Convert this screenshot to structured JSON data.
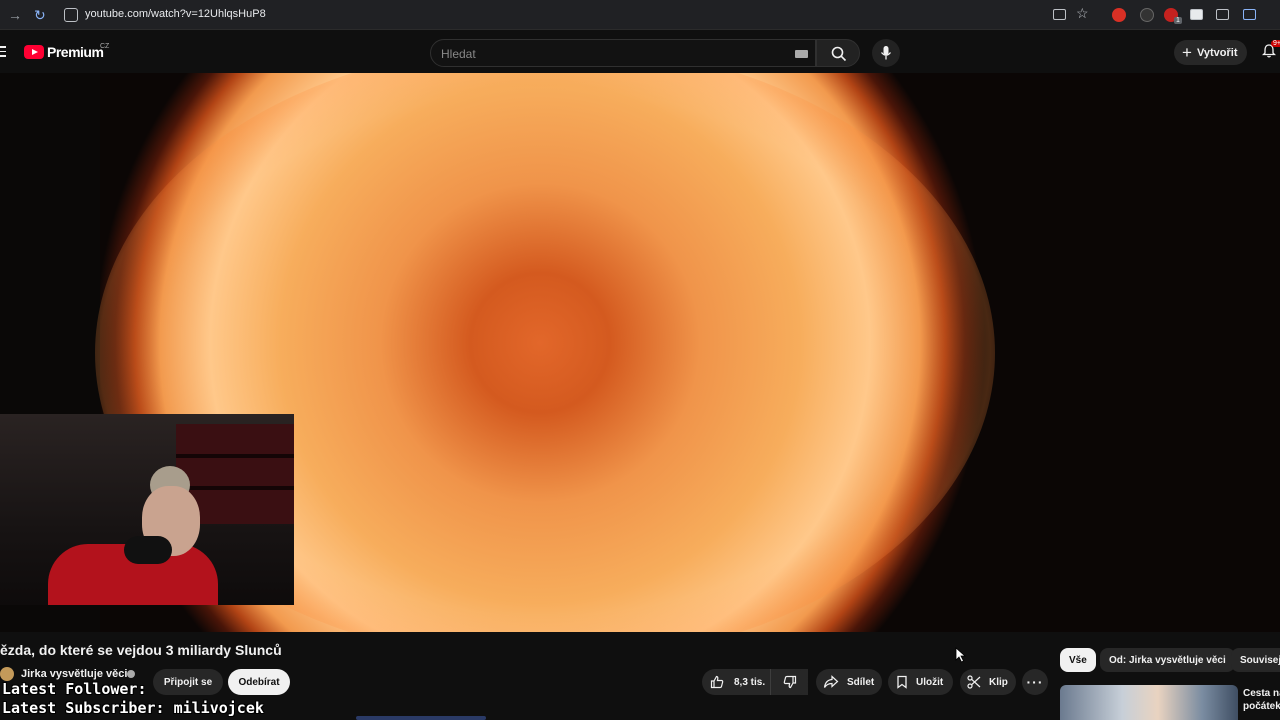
{
  "browser": {
    "url": "youtube.com/watch?v=12UhlqsHuP8",
    "extension_badge": "1"
  },
  "header": {
    "logo_text": "Premium",
    "country_code": "CZ",
    "search_placeholder": "Hledat",
    "create_label": "Vytvořit",
    "notification_count": "9+"
  },
  "video": {
    "title": "ězda, do které se vejdou 3 miliardy Slunců",
    "channel_name": "Jirka vysvětluje věci",
    "join_label": "Připojit se",
    "subscribe_label": "Odebírat",
    "like_count": "8,3 tis.",
    "share_label": "Sdílet",
    "save_label": "Uložit",
    "clip_label": "Klip",
    "more_label": "···"
  },
  "overlay": {
    "latest_follower": "Latest Follower:",
    "latest_subscriber": "Latest Subscriber: milivojcek"
  },
  "sidebar": {
    "chips": [
      "Vše",
      "Od: Jirka vysvětluje věci",
      "Souvisej"
    ],
    "related": [
      {
        "title_line1": "Cesta na",
        "title_line2": "počátek"
      }
    ]
  },
  "colors": {
    "background": "#0f0f0f",
    "brand_red": "#ff0033",
    "chip_bg": "#272727",
    "subscribe_bg": "#f1f1f1"
  }
}
